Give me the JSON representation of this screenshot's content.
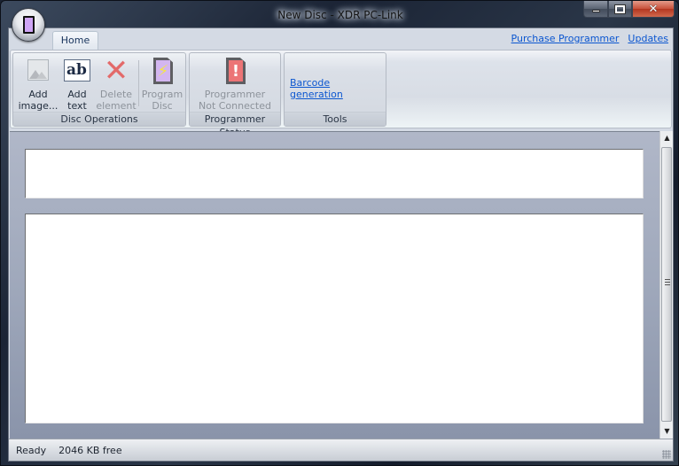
{
  "window": {
    "title": "New Disc - XDR PC-Link",
    "caption_buttons": {
      "minimize": "minimize",
      "maximize": "maximize",
      "close": "✕"
    }
  },
  "app_menu": {
    "icon": "disc-icon"
  },
  "tabs": [
    {
      "label": "Home",
      "active": true
    }
  ],
  "top_links": {
    "purchase": "Purchase Programmer",
    "updates": "Updates"
  },
  "ribbon": {
    "groups": [
      {
        "label": "Disc Operations",
        "buttons": [
          {
            "label_line1": "Add",
            "label_line2": "image...",
            "icon": "image-icon",
            "enabled": true
          },
          {
            "label_line1": "Add",
            "label_line2": "text",
            "icon": "text-icon",
            "icon_text": "ab",
            "enabled": true
          },
          {
            "label_line1": "Delete",
            "label_line2": "element",
            "icon": "delete-icon",
            "icon_text": "✕",
            "enabled": false
          },
          {
            "label_line1": "Program",
            "label_line2": "Disc",
            "icon": "program-disc-icon",
            "icon_text": "⚡",
            "enabled": false
          }
        ]
      },
      {
        "label": "Programmer Status",
        "buttons": [
          {
            "label_line1": "Programmer",
            "label_line2": "Not Connected",
            "icon": "warning-card-icon",
            "icon_text": "!",
            "enabled": false
          }
        ]
      },
      {
        "label": "Tools",
        "links": [
          {
            "label": "Barcode generation"
          }
        ]
      }
    ]
  },
  "workspace": {
    "top_panel_text": "",
    "main_panel_text": ""
  },
  "scrollbar": {
    "up": "▲",
    "down": "▼"
  },
  "status": {
    "state": "Ready",
    "free_space": "2046 KB free"
  },
  "colors": {
    "link": "#0b56d0",
    "delete_red": "#e36a6a",
    "sd_purple": "#d3b6f0",
    "sd_red": "#ec7476"
  }
}
